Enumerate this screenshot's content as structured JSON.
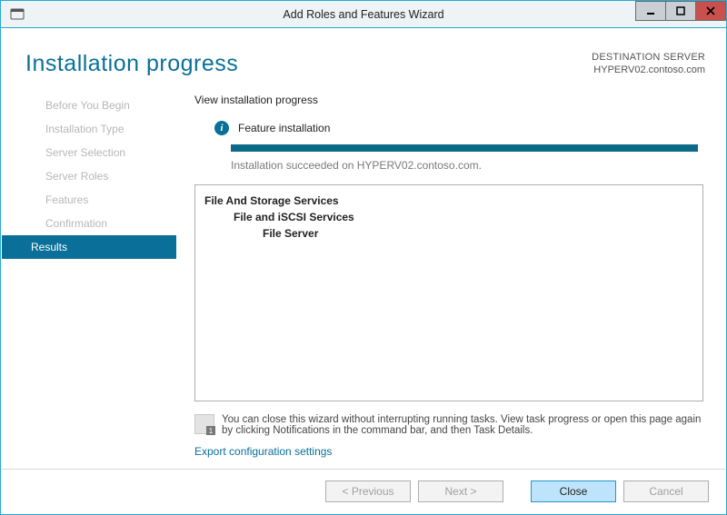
{
  "window": {
    "title": "Add Roles and Features Wizard"
  },
  "page": {
    "title": "Installation progress"
  },
  "destination": {
    "label": "DESTINATION SERVER",
    "server": "HYPERV02.contoso.com"
  },
  "sidebar": {
    "items": [
      "Before You Begin",
      "Installation Type",
      "Server Selection",
      "Server Roles",
      "Features",
      "Confirmation",
      "Results"
    ],
    "active_index": 6
  },
  "main": {
    "subhead": "View installation progress",
    "info_label": "Feature installation",
    "status_text": "Installation succeeded on HYPERV02.contoso.com.",
    "results": {
      "lvl0": "File And Storage Services",
      "lvl1": "File and iSCSI Services",
      "lvl2": "File Server"
    },
    "tip_text": "You can close this wizard without interrupting running tasks. View task progress or open this page again by clicking Notifications in the command bar, and then Task Details.",
    "export_link": "Export configuration settings"
  },
  "footer": {
    "previous": "< Previous",
    "next": "Next >",
    "close": "Close",
    "cancel": "Cancel"
  }
}
